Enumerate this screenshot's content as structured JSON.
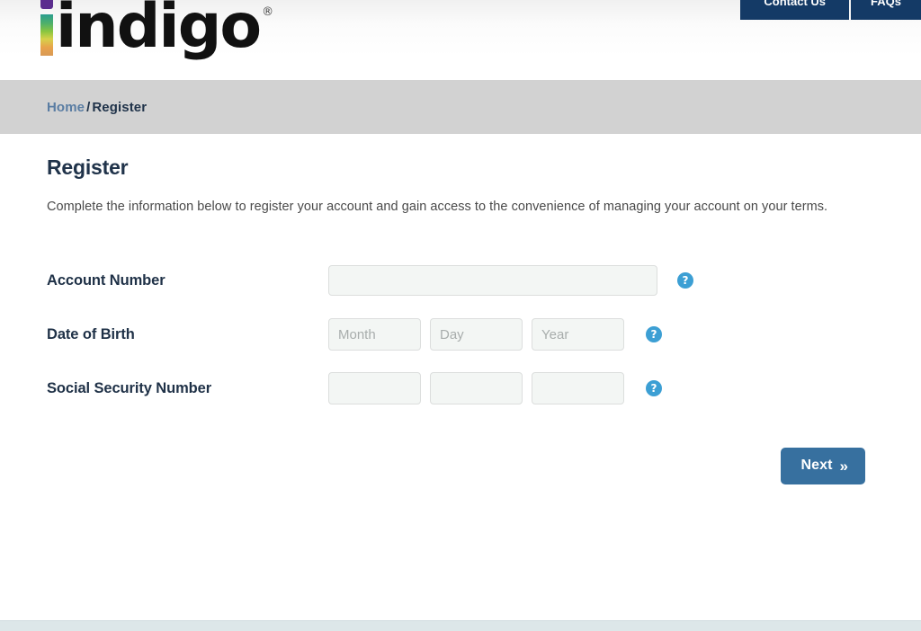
{
  "header": {
    "logo": {
      "wordmark": "indigo",
      "registered_mark": "®"
    },
    "nav": [
      {
        "label": "Contact Us",
        "name": "contact-us"
      },
      {
        "label": "FAQs",
        "name": "faqs"
      }
    ]
  },
  "breadcrumb": {
    "home_label": "Home",
    "separator": "/",
    "current_label": "Register"
  },
  "main": {
    "title": "Register",
    "description": "Complete the information below to register your account and gain access to the convenience of managing your account on your terms.",
    "form": {
      "account_number": {
        "label": "Account Number",
        "value": "",
        "placeholder": "",
        "help_icon": "question-mark-icon",
        "help_glyph": "?"
      },
      "date_of_birth": {
        "label": "Date of Birth",
        "month": {
          "value": "",
          "placeholder": "Month"
        },
        "day": {
          "value": "",
          "placeholder": "Day"
        },
        "year": {
          "value": "",
          "placeholder": "Year"
        },
        "help_icon": "question-mark-icon",
        "help_glyph": "?"
      },
      "social_security_number": {
        "label": "Social Security Number",
        "part1": {
          "value": "",
          "placeholder": ""
        },
        "part2": {
          "value": "",
          "placeholder": ""
        },
        "part3": {
          "value": "",
          "placeholder": ""
        },
        "help_icon": "question-mark-icon",
        "help_glyph": "?"
      },
      "submit": {
        "label": "Next",
        "chevron_glyph": "»"
      }
    }
  },
  "colors": {
    "nav_button_bg": "#143a66",
    "breadcrumb_bar_bg": "#d2d2d2",
    "heading_navy": "#20334a",
    "label_navy": "#1f3147",
    "link_blue": "#5a7da3",
    "help_icon_blue": "#3c9fd4",
    "primary_button_blue": "#37709f",
    "input_bg": "#f3f6f4",
    "input_border": "#dcdedd",
    "footer_strip": "#dde7e9",
    "logo_dot_purple": "#5b2d8e"
  }
}
